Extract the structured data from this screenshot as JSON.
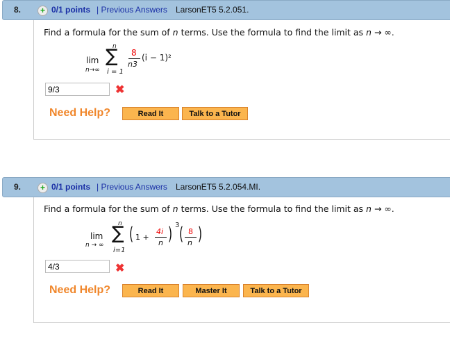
{
  "common": {
    "question_text_pre": "Find a formula for the sum of ",
    "n": "n",
    "question_text_post": " terms. Use the formula to find the limit as ",
    "limit_arrow": " → ∞.",
    "need_help": "Need Help?",
    "read_it": "Read It",
    "master_it": "Master It",
    "talk_tutor": "Talk to a Tutor",
    "points": "0/1 points",
    "previous_answers": "| Previous Answers"
  },
  "q8": {
    "number": "8.",
    "code": "LarsonET5 5.2.051.",
    "answer": "9/3",
    "lim": "lim",
    "lim_sub": "n→∞",
    "sum_top": "n",
    "sum_bottom": "i = 1",
    "frac_num": "8",
    "frac_den": "n3",
    "term": "(i − 1)²"
  },
  "q9": {
    "number": "9.",
    "code": "LarsonET5 5.2.054.MI.",
    "answer": "4/3",
    "lim": "lim",
    "lim_sub": "n → ∞",
    "sum_top": "n",
    "sum_bottom": "i=1",
    "one_plus": "1 +",
    "frac1_num": "4i",
    "frac1_den": "n",
    "power": "3",
    "frac2_num": "8",
    "frac2_den": "n"
  }
}
